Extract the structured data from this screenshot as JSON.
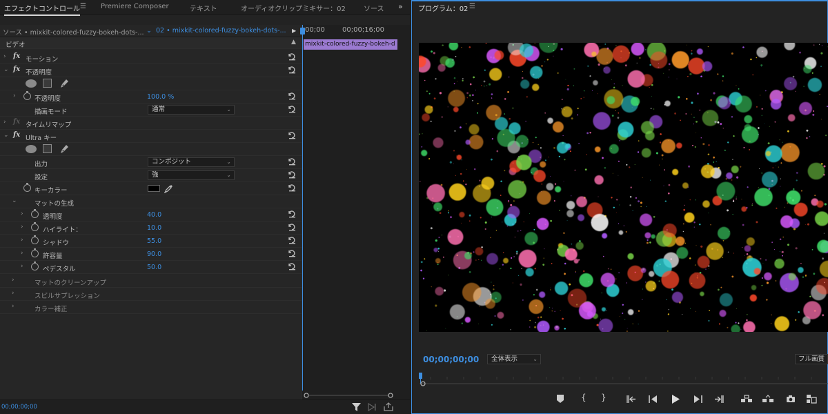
{
  "tabs": {
    "effect_controls": "エフェクトコントロール",
    "premiere_composer": "Premiere Composer",
    "text": "テキスト",
    "audio_clip_mixer": "オーディオクリップミキサー：02",
    "source": "ソース",
    "program": "プログラム：02"
  },
  "source_bar": {
    "source_label": "ソース • mixkit-colored-fuzzy-bokeh-dots-...",
    "sequence_label": "02 • mixkit-colored-fuzzy-bokeh-dots-..."
  },
  "timeline": {
    "time_start": "00;00",
    "time_end": "00;00;16;00",
    "clip_name": "mixkit-colored-fuzzy-bokeh-d"
  },
  "effects": {
    "video_header": "ビデオ",
    "motion": "モーション",
    "opacity": "不透明度",
    "opacity_param": "不透明度",
    "opacity_value": "100.0 %",
    "blend_mode_label": "描画モード",
    "blend_mode_value": "通常",
    "time_remap": "タイムリマップ",
    "ultra_key": "Ultra キー",
    "output_label": "出力",
    "output_value": "コンポジット",
    "setting_label": "設定",
    "setting_value": "強",
    "key_color_label": "キーカラー",
    "matte_generation": "マットの生成",
    "transparency_label": "透明度",
    "transparency_value": "40.0",
    "highlight_label": "ハイライト：",
    "highlight_value": "10.0",
    "shadow_label": "シャドウ",
    "shadow_value": "55.0",
    "tolerance_label": "許容量",
    "tolerance_value": "90.0",
    "pedestal_label": "ペデスタル",
    "pedestal_value": "50.0",
    "matte_cleanup": "マットのクリーンアップ",
    "spill_suppression": "スピルサプレッション",
    "color_correction": "カラー補正"
  },
  "status": {
    "timecode_left": "00;00;00;00"
  },
  "program": {
    "timecode": "00;00;00;00",
    "zoom": "全体表示",
    "quality": "フル画質"
  },
  "colors": {
    "accent": "#3d8ee0",
    "clip": "#9b7ad1"
  }
}
